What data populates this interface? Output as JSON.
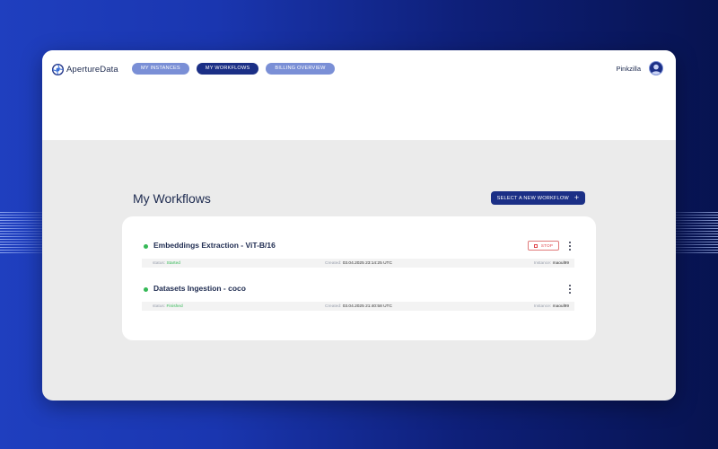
{
  "app": {
    "brand": "ApertureData"
  },
  "nav": {
    "items": [
      {
        "label": "MY INSTANCES",
        "active": false
      },
      {
        "label": "MY WORKFLOWS",
        "active": true
      },
      {
        "label": "BILLING OVERVIEW",
        "active": false
      }
    ]
  },
  "user": {
    "name": "Pinkzilla"
  },
  "page": {
    "title": "My Workflows",
    "select_button_label": "SELECT A NEW WORKFLOW",
    "select_button_icon": "+"
  },
  "workflows": [
    {
      "title": "Embeddings Extraction - ViT-B/16",
      "status_label": "status:",
      "status": "Started",
      "created_label": "Created:",
      "created": "03.04.2025 23:14:25 UTC",
      "instance_label": "Instance:",
      "instance": "maoul99",
      "stop_label": "STOP",
      "status_color": "#35b957"
    },
    {
      "title": "Datasets Ingestion - coco",
      "status_label": "status:",
      "status": "Finished",
      "created_label": "Created:",
      "created": "03.04.2025 21:40:58 UTC",
      "instance_label": "Instance:",
      "instance": "maoul99",
      "status_color": "#35b957"
    }
  ],
  "colors": {
    "accent": "#1b2f86",
    "nav_inactive": "#7a8fd6",
    "status_green": "#35b957",
    "stop_red": "#e0454b"
  }
}
